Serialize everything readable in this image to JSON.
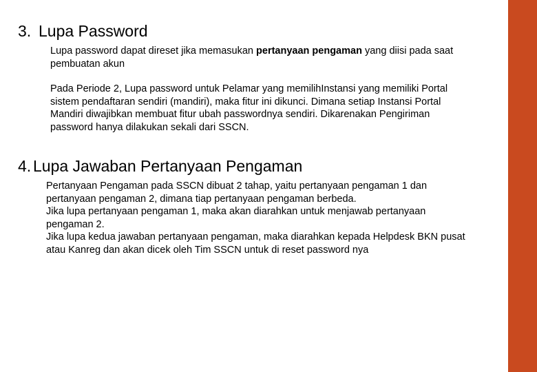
{
  "section3": {
    "number": "3.",
    "title": "Lupa Password",
    "p1_a": "Lupa password dapat direset jika memasukan ",
    "p1_bold": "pertanyaan pengaman",
    "p1_b": " yang diisi pada saat pembuatan akun",
    "p2": "Pada Periode 2, Lupa password untuk  Pelamar yang memilihInstansi yang memiliki Portal sistem pendaftaran sendiri (mandiri), maka fitur ini dikunci. Dimana setiap Instansi Portal Mandiri diwajibkan membuat fitur ubah passwordnya sendiri. Dikarenakan Pengiriman password hanya dilakukan sekali dari SSCN."
  },
  "section4": {
    "number": "4.",
    "title": "Lupa Jawaban Pertanyaan Pengaman",
    "p1": "Pertanyaan Pengaman pada SSCN dibuat 2 tahap, yaitu pertanyaan pengaman 1 dan pertanyaan pengaman 2, dimana tiap pertanyaan pengaman berbeda.",
    "p2": "Jika lupa pertanyaan pengaman 1, maka akan diarahkan untuk menjawab pertanyaan pengaman 2.",
    "p3": "Jika lupa kedua jawaban pertanyaan pengaman, maka diarahkan kepada Helpdesk BKN pusat atau Kanreg dan akan dicek oleh Tim SSCN untuk di reset password nya"
  }
}
